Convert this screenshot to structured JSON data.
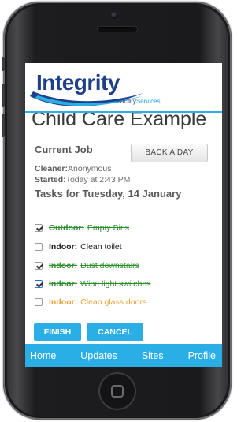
{
  "brand": {
    "name": "Integrity",
    "tagline_main": "Facility",
    "tagline_accent": "Services",
    "colors": {
      "primary": "#1e3f8a",
      "accent": "#2aaee6"
    }
  },
  "page": {
    "title": "Child Care Example"
  },
  "job": {
    "section_title": "Current Job",
    "back_button": "BACK A DAY",
    "cleaner_label": "Cleaner:",
    "cleaner_value": "Anonymous",
    "started_label": "Started:",
    "started_value": "Today at 2:43 PM"
  },
  "tasks": {
    "heading": "Tasks for Tuesday, 14 January",
    "items": [
      {
        "category": "Outdoor:",
        "task": "Empty Bins",
        "checked": true,
        "status": "done"
      },
      {
        "category": "Indoor:",
        "task": "Clean toilet",
        "checked": false,
        "status": "todo"
      },
      {
        "category": "Indoor:",
        "task": "Dust downstairs",
        "checked": true,
        "status": "done"
      },
      {
        "category": "Indoor:",
        "task": "Wipe light switches",
        "checked": true,
        "status": "done"
      },
      {
        "category": "Indoor:",
        "task": "Clean glass doors",
        "checked": false,
        "status": "pending"
      }
    ]
  },
  "actions": {
    "finish": "FINISH",
    "cancel": "CANCEL"
  },
  "nav": {
    "home": "Home",
    "updates": "Updates",
    "sites": "Sites",
    "profile": "Profile"
  }
}
